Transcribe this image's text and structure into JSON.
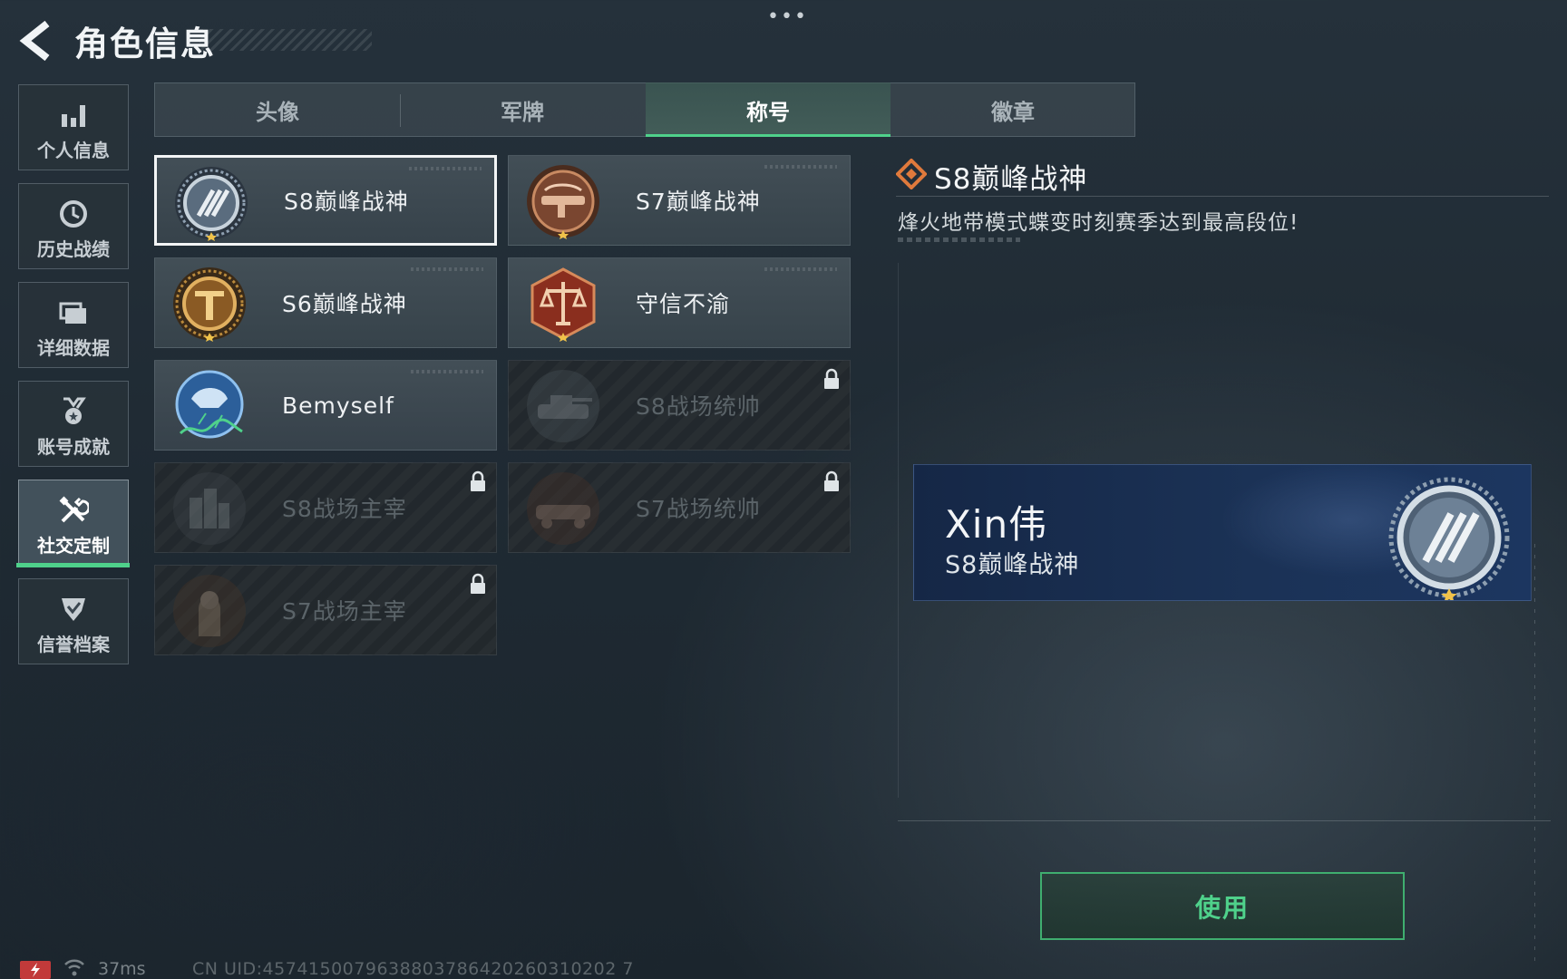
{
  "header": {
    "title": "角色信息",
    "more_glyph": "•••"
  },
  "sidebar": {
    "items": [
      {
        "label": "个人信息",
        "icon": "bar-chart-icon",
        "active": false
      },
      {
        "label": "历史战绩",
        "icon": "clock-history-icon",
        "active": false
      },
      {
        "label": "详细数据",
        "icon": "folder-stack-icon",
        "active": false
      },
      {
        "label": "账号成就",
        "icon": "medal-icon",
        "active": false
      },
      {
        "label": "社交定制",
        "icon": "tools-icon",
        "active": true
      },
      {
        "label": "信誉档案",
        "icon": "shield-check-icon",
        "active": false
      }
    ]
  },
  "tabs": [
    {
      "label": "头像",
      "active": false
    },
    {
      "label": "军牌",
      "active": false
    },
    {
      "label": "称号",
      "active": true
    },
    {
      "label": "徽章",
      "active": false
    }
  ],
  "titles": [
    {
      "name": "S8巅峰战神",
      "emblem": "s8-peak-emblem",
      "locked": false,
      "selected": true
    },
    {
      "name": "S7巅峰战神",
      "emblem": "s7-peak-emblem",
      "locked": false,
      "selected": false
    },
    {
      "name": "S6巅峰战神",
      "emblem": "s6-peak-emblem",
      "locked": false,
      "selected": false
    },
    {
      "name": "守信不渝",
      "emblem": "scales-emblem",
      "locked": false,
      "selected": false
    },
    {
      "name": "Bemyself",
      "emblem": "signature-emblem",
      "locked": false,
      "selected": false
    },
    {
      "name": "S8战场统帅",
      "emblem": "tank-emblem",
      "locked": true,
      "selected": false
    },
    {
      "name": "S8战场主宰",
      "emblem": "city-emblem",
      "locked": true,
      "selected": false
    },
    {
      "name": "S7战场统帅",
      "emblem": "vehicle-emblem",
      "locked": true,
      "selected": false
    },
    {
      "name": "S7战场主宰",
      "emblem": "soldier-emblem",
      "locked": true,
      "selected": false
    }
  ],
  "detail": {
    "title": "S8巅峰战神",
    "description": "烽火地带模式蝶变时刻赛季达到最高段位!"
  },
  "preview": {
    "player_name": "Xin伟",
    "title": "S8巅峰战神"
  },
  "use_button": "使用",
  "status": {
    "ping": "37ms",
    "uid": "CN UID:4574150079638803786420260310202 7"
  },
  "colors": {
    "accent_green": "#4fd18b",
    "detail_diamond": "#e07a3c",
    "battery_low": "#c23a3a"
  }
}
